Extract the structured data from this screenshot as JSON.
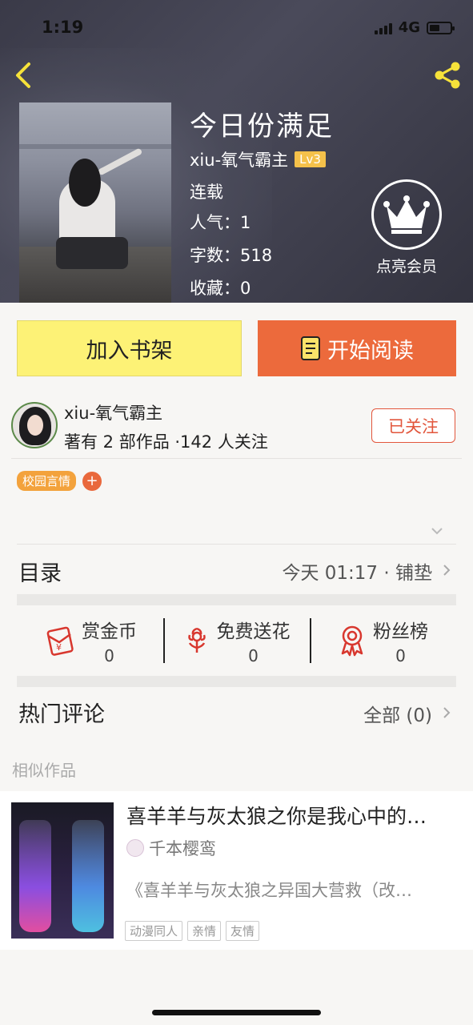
{
  "status_bar": {
    "time": "1:19",
    "network": "4G"
  },
  "book": {
    "title": "今日份满足",
    "author": "xiu-氧气霸主",
    "level": "Lv3",
    "status": "连载",
    "popularity": "人气：1",
    "words": "字数：518",
    "favorites": "收藏：0"
  },
  "vip": {
    "label": "点亮会员"
  },
  "actions": {
    "shelf": "加入书架",
    "read": "开始阅读"
  },
  "author_block": {
    "name": "xiu-氧气霸主",
    "stats": "著有 2 部作品 ·142 人关注",
    "follow": "已关注"
  },
  "tags": [
    "校园言情"
  ],
  "tag_add": "+",
  "toc": {
    "title": "目录",
    "update": "今天 01:17 · 铺垫"
  },
  "rewards": [
    {
      "label": "赏金币",
      "count": "0",
      "icon": "coin-envelope-icon"
    },
    {
      "label": "免费送花",
      "count": "0",
      "icon": "flower-icon"
    },
    {
      "label": "粉丝榜",
      "count": "0",
      "icon": "medal-icon"
    }
  ],
  "comments": {
    "title": "热门评论",
    "all": "全部 (0)"
  },
  "similar": {
    "header": "相似作品",
    "items": [
      {
        "title": "喜羊羊与灰太狼之你是我心中的…",
        "author": "千本樱鸾",
        "desc": "《喜羊羊与灰太狼之异国大营救（改…",
        "tags": [
          "动漫同人",
          "亲情",
          "友情"
        ]
      }
    ]
  },
  "colors": {
    "accent_orange": "#ec6a3c",
    "shelf_yellow": "#fdf276",
    "tag_orange": "#f3a23c",
    "follow_red": "#e2563c",
    "level_gold": "#f5c14a"
  }
}
